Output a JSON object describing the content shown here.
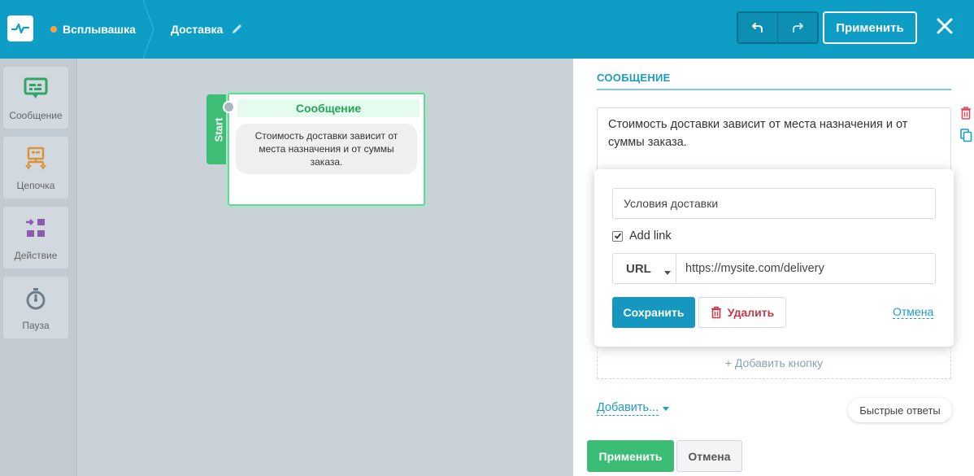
{
  "header": {
    "popup_name": "Всплывашка",
    "flow_name": "Доставка",
    "apply_label": "Применить",
    "icons": {
      "logo": "pulse-logo-icon",
      "edit": "pencil-icon",
      "undo": "undo-icon",
      "redo": "redo-icon",
      "close": "close-icon"
    },
    "status_color": "#f5a33d",
    "bar_color": "#0e9ec5"
  },
  "palette": {
    "items": [
      {
        "label": "Сообщение",
        "icon": "message-icon",
        "color": "#2ea66a"
      },
      {
        "label": "Цепочка",
        "icon": "chain-icon",
        "color": "#d9943a"
      },
      {
        "label": "Действие",
        "icon": "action-icon",
        "color": "#8a5bb0"
      },
      {
        "label": "Пауза",
        "icon": "timer-icon",
        "color": "#6d7f8c"
      }
    ]
  },
  "canvas": {
    "start_label": "Start",
    "node": {
      "title": "Сообщение",
      "text": "Стоимость доставки зависит от места назначения и от суммы заказа."
    }
  },
  "panel": {
    "section_title": "СООБЩЕНИЕ",
    "message_text": "Стоимость доставки зависит от места назначения и от суммы заказа.",
    "popover": {
      "button_text": "Условия доставки",
      "add_link_label": "Add link",
      "add_link_checked": true,
      "url_type": "URL",
      "url_value": "https://mysite.com/delivery",
      "save_label": "Сохранить",
      "delete_label": "Удалить",
      "cancel_label": "Отмена"
    },
    "add_button_label": "+ Добавить кнопку",
    "add_more_label": "Добавить...",
    "quick_replies_label": "Быстрые ответы",
    "apply_label": "Применить",
    "cancel_label": "Отмена"
  }
}
